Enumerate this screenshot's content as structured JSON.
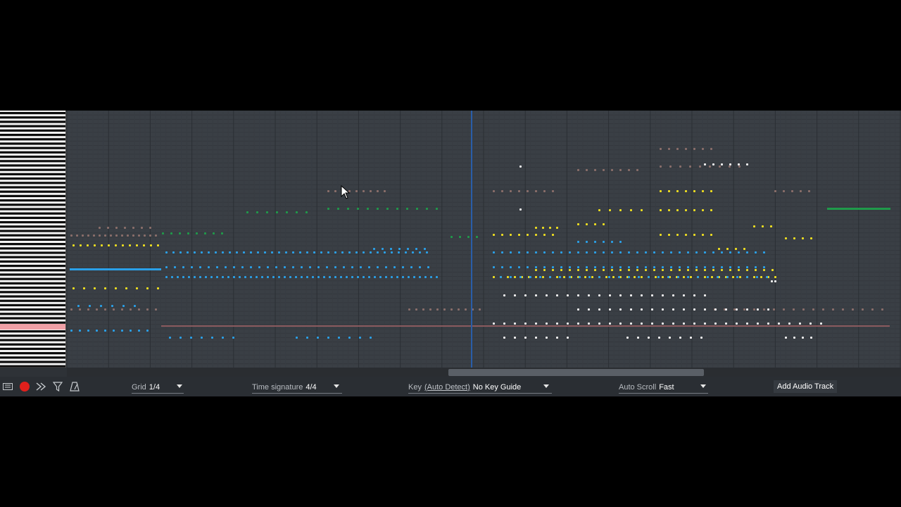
{
  "toolbar": {
    "grid_label": "Grid",
    "grid_value": "1/4",
    "time_signature_label": "Time signature",
    "time_signature_value": "4/4",
    "key_label": "Key",
    "key_auto_detect": "(Auto Detect)",
    "key_value": "No Key Guide",
    "auto_scroll_label": "Auto Scroll",
    "auto_scroll_value": "Fast",
    "add_audio_track": "Add Audio Track"
  },
  "icons": [
    "keyboard-icon",
    "record-icon",
    "quantize-icon",
    "filter-icon",
    "metronome-icon"
  ],
  "colors": {
    "background": "#000000",
    "roll_bg": "#3a3f45",
    "toolbar_bg": "#2a2e33",
    "record": "#e0201c",
    "note_yellow": "#f0e020",
    "note_blue": "#2aa0e8",
    "note_green": "#1f9a4a",
    "note_brown": "#8a6e6a",
    "note_white": "#f2f2f2",
    "playhead": "#2a5da8"
  },
  "scrollbar": {
    "position_fraction": 0.46
  }
}
